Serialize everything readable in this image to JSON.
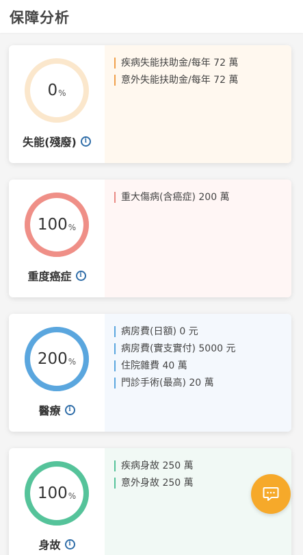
{
  "page": {
    "title": "保障分析"
  },
  "cards": [
    {
      "value": "0",
      "unit": "%",
      "fill_fraction": 0,
      "category": "失能(殘廢)",
      "info_icon": "info-icon",
      "ring_color": "#fbe7cc",
      "ring_track": "#fde9d2",
      "bar_color": "#f0a04b",
      "bg_color": "#fff8ef",
      "items": [
        "疾病失能扶助金/每年 72 萬",
        "意外失能扶助金/每年 72 萬"
      ]
    },
    {
      "value": "100",
      "unit": "%",
      "fill_fraction": 1,
      "category": "重度癌症",
      "info_icon": "info-icon",
      "ring_color": "#ef8f87",
      "ring_track": "#f6c7c2",
      "bar_color": "#e98a84",
      "bg_color": "#fff6f5",
      "items": [
        "重大傷病(含癌症) 200 萬"
      ]
    },
    {
      "value": "200",
      "unit": "%",
      "fill_fraction": 1,
      "category": "醫療",
      "info_icon": "info-icon",
      "ring_color": "#5aa6de",
      "ring_track": "#b9daf2",
      "bar_color": "#5aa6de",
      "bg_color": "#f4f8fd",
      "items": [
        "病房費(日額) 0 元",
        "病房費(實支實付) 5000 元",
        "住院雜費 40 萬",
        "門診手術(最高) 20 萬"
      ]
    },
    {
      "value": "100",
      "unit": "%",
      "fill_fraction": 1,
      "category": "身故",
      "info_icon": "info-icon",
      "ring_color": "#55c39a",
      "ring_track": "#bfe9d7",
      "bar_color": "#55c39a",
      "bg_color": "#f1f9f5",
      "items": [
        "疾病身故 250 萬",
        "意外身故 250 萬"
      ]
    }
  ],
  "fab": {
    "icon": "chat-bubble-icon",
    "color": "#f6a92a"
  }
}
